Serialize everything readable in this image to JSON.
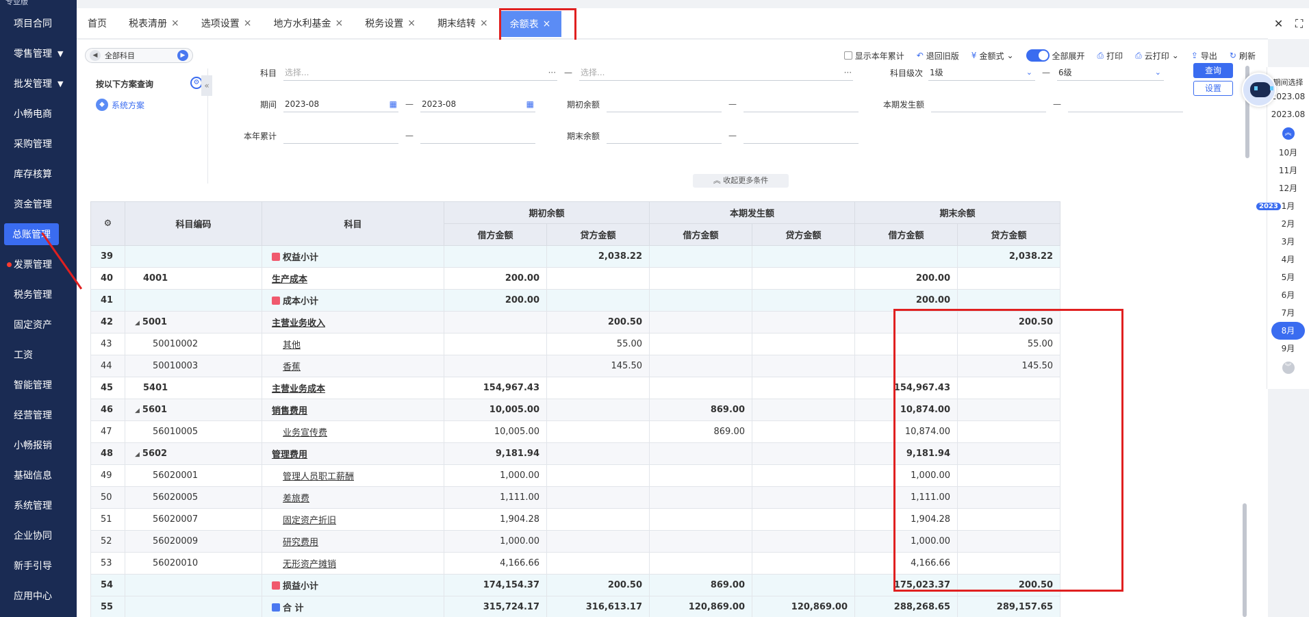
{
  "sidebar": {
    "top_stub": "专业版",
    "items": [
      {
        "label": "项目合同"
      },
      {
        "label": "零售管理",
        "chevron": true
      },
      {
        "label": "批发管理",
        "chevron": true
      },
      {
        "label": "小畅电商"
      },
      {
        "label": "采购管理"
      },
      {
        "label": "库存核算"
      },
      {
        "label": "资金管理"
      },
      {
        "label": "总账管理",
        "active": true
      },
      {
        "label": "发票管理",
        "dot": true
      },
      {
        "label": "税务管理"
      },
      {
        "label": "固定资产"
      },
      {
        "label": "工资"
      },
      {
        "label": "智能管理"
      },
      {
        "label": "经营管理"
      },
      {
        "label": "小畅报销"
      },
      {
        "label": "基础信息"
      },
      {
        "label": "系统管理"
      },
      {
        "label": "企业协同"
      },
      {
        "label": "新手引导"
      },
      {
        "label": "应用中心"
      }
    ]
  },
  "tabs": [
    {
      "label": "首页",
      "close": false
    },
    {
      "label": "税表清册",
      "close": true
    },
    {
      "label": "选项设置",
      "close": true
    },
    {
      "label": "地方水利基金",
      "close": true
    },
    {
      "label": "税务设置",
      "close": true
    },
    {
      "label": "期末结转",
      "close": true
    },
    {
      "label": "余额表",
      "close": true,
      "active": true
    }
  ],
  "tab_close_glyph": "×",
  "toolbar": {
    "subject_select": "全部科目",
    "show_year_total": "显示本年累计",
    "back_old": "退回旧版",
    "amount_style": "金额式",
    "expand_all": "全部展开",
    "print": "打印",
    "cloud_print": "云打印",
    "export": "导出",
    "refresh": "刷新"
  },
  "filter": {
    "query_by_plan": "按以下方案查询",
    "system_plan": "系统方案",
    "subject_label": "科目",
    "subject_placeholder_1": "选择...",
    "subject_placeholder_2": "选择...",
    "level_label": "科目级次",
    "level_from": "1级",
    "level_to": "6级",
    "period_label": "期间",
    "period_from": "2023-08",
    "period_to": "2023-08",
    "opening_label": "期初余额",
    "current_label": "本期发生额",
    "year_total_label": "本年累计",
    "closing_label": "期末余额",
    "query_button": "查询",
    "settings_button": "设置",
    "more_conditions": "收起更多条件",
    "dash": "—"
  },
  "table": {
    "headers": {
      "code": "科目编码",
      "name": "科目",
      "opening": "期初余额",
      "current": "本期发生额",
      "closing": "期末余额",
      "debit": "借方金额",
      "credit": "贷方金额"
    },
    "rows": [
      {
        "idx": "39",
        "code": "",
        "name": "权益小计",
        "type": "sub",
        "o_d": "",
        "o_c": "2,038.22",
        "c_d": "",
        "c_c": "",
        "e_d": "",
        "e_c": "2,038.22"
      },
      {
        "idx": "40",
        "code": "4001",
        "name": "生产成本",
        "type": "bold",
        "o_d": "200.00",
        "o_c": "",
        "c_d": "",
        "c_c": "",
        "e_d": "200.00",
        "e_c": ""
      },
      {
        "idx": "41",
        "code": "",
        "name": "成本小计",
        "type": "sub",
        "o_d": "200.00",
        "o_c": "",
        "c_d": "",
        "c_c": "",
        "e_d": "200.00",
        "e_c": ""
      },
      {
        "idx": "42",
        "code": "5001",
        "name": "主营业务收入",
        "type": "bold-alt",
        "tri": true,
        "o_d": "",
        "o_c": "200.50",
        "c_d": "",
        "c_c": "",
        "e_d": "",
        "e_c": "200.50"
      },
      {
        "idx": "43",
        "code": "50010002",
        "name": "其他",
        "type": "leaf",
        "o_d": "",
        "o_c": "55.00",
        "c_d": "",
        "c_c": "",
        "e_d": "",
        "e_c": "55.00"
      },
      {
        "idx": "44",
        "code": "50010003",
        "name": "香蕉",
        "type": "leaf-alt",
        "o_d": "",
        "o_c": "145.50",
        "c_d": "",
        "c_c": "",
        "e_d": "",
        "e_c": "145.50"
      },
      {
        "idx": "45",
        "code": "5401",
        "name": "主营业务成本",
        "type": "bold",
        "o_d": "154,967.43",
        "o_c": "",
        "c_d": "",
        "c_c": "",
        "e_d": "154,967.43",
        "e_c": ""
      },
      {
        "idx": "46",
        "code": "5601",
        "name": "销售费用",
        "type": "bold-alt",
        "tri": true,
        "o_d": "10,005.00",
        "o_c": "",
        "c_d": "869.00",
        "c_c": "",
        "e_d": "10,874.00",
        "e_c": ""
      },
      {
        "idx": "47",
        "code": "56010005",
        "name": "业务宣传费",
        "type": "leaf",
        "o_d": "10,005.00",
        "o_c": "",
        "c_d": "869.00",
        "c_c": "",
        "e_d": "10,874.00",
        "e_c": ""
      },
      {
        "idx": "48",
        "code": "5602",
        "name": "管理费用",
        "type": "bold-alt",
        "tri": true,
        "o_d": "9,181.94",
        "o_c": "",
        "c_d": "",
        "c_c": "",
        "e_d": "9,181.94",
        "e_c": ""
      },
      {
        "idx": "49",
        "code": "56020001",
        "name": "管理人员职工薪酬",
        "type": "leaf",
        "o_d": "1,000.00",
        "o_c": "",
        "c_d": "",
        "c_c": "",
        "e_d": "1,000.00",
        "e_c": ""
      },
      {
        "idx": "50",
        "code": "56020005",
        "name": "差旅费",
        "type": "leaf-alt",
        "o_d": "1,111.00",
        "o_c": "",
        "c_d": "",
        "c_c": "",
        "e_d": "1,111.00",
        "e_c": ""
      },
      {
        "idx": "51",
        "code": "56020007",
        "name": "固定资产折旧",
        "type": "leaf",
        "o_d": "1,904.28",
        "o_c": "",
        "c_d": "",
        "c_c": "",
        "e_d": "1,904.28",
        "e_c": ""
      },
      {
        "idx": "52",
        "code": "56020009",
        "name": "研究费用",
        "type": "leaf-alt",
        "o_d": "1,000.00",
        "o_c": "",
        "c_d": "",
        "c_c": "",
        "e_d": "1,000.00",
        "e_c": ""
      },
      {
        "idx": "53",
        "code": "56020010",
        "name": "无形资产摊销",
        "type": "leaf",
        "o_d": "4,166.66",
        "o_c": "",
        "c_d": "",
        "c_c": "",
        "e_d": "4,166.66",
        "e_c": ""
      },
      {
        "idx": "54",
        "code": "",
        "name": "损益小计",
        "type": "sub",
        "o_d": "174,154.37",
        "o_c": "200.50",
        "c_d": "869.00",
        "c_c": "",
        "e_d": "175,023.37",
        "e_c": "200.50"
      },
      {
        "idx": "55",
        "code": "",
        "name": "合  计",
        "type": "sub-blue",
        "o_d": "315,724.17",
        "o_c": "316,613.17",
        "c_d": "120,869.00",
        "c_c": "120,869.00",
        "e_d": "288,268.65",
        "e_c": "289,157.65"
      }
    ]
  },
  "period_panel": {
    "title": "期间选择",
    "range_start": "2023.08",
    "range_end": "2023.08",
    "year_badge": "2023",
    "months": [
      "10月",
      "11月",
      "12月",
      "1月",
      "2月",
      "3月",
      "4月",
      "5月",
      "6月",
      "7月",
      "8月",
      "9月"
    ],
    "current_month": "8月"
  },
  "colors": {
    "sidebar_bg": "#1a2b53",
    "accent": "#3a6cf0",
    "highlight_red": "#e02020"
  }
}
